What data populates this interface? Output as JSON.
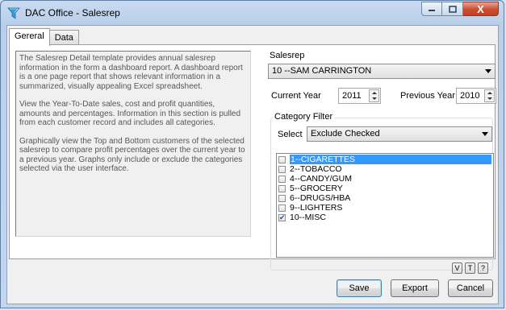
{
  "window": {
    "title": "DAC Office - Salesrep",
    "close_glyph": "X"
  },
  "tabs": [
    {
      "label": "Gereral"
    },
    {
      "label": "Data"
    }
  ],
  "description": {
    "p1": "The Salesrep Detail template provides annual salesrep information in the form a dashboard report. A dashboard report is a one page report that shows relevant information in a summarized, visually appealing Excel spreadsheet.",
    "p2": "View the Year-To-Date sales, cost and profit quantities, amounts and percentages. Information in this section is pulled from each customer record and includes all categories.",
    "p3": "Graphically view the Top and Bottom customers of the selected salesrep to compare profit percentages over the current year to a previous year. Graphs only include or exclude the categories selected via the user interface."
  },
  "salesrep": {
    "label": "Salesrep",
    "value": "10  --SAM CARRINGTON"
  },
  "current_year": {
    "label": "Current Year",
    "value": "2011"
  },
  "previous_year": {
    "label": "Previous Year",
    "value": "2010"
  },
  "category_filter": {
    "legend": "Category Filter",
    "select_label": "Select",
    "select_value": "Exclude Checked",
    "items": [
      {
        "label": "1--CIGARETTES",
        "checked": false,
        "selected": true
      },
      {
        "label": "2--TOBACCO",
        "checked": false,
        "selected": false
      },
      {
        "label": "4--CANDY/GUM",
        "checked": false,
        "selected": false
      },
      {
        "label": "5--GROCERY",
        "checked": false,
        "selected": false
      },
      {
        "label": "6--DRUGS/HBA",
        "checked": false,
        "selected": false
      },
      {
        "label": "9--LIGHTERS",
        "checked": false,
        "selected": false
      },
      {
        "label": "10--MISC",
        "checked": true,
        "selected": false
      }
    ]
  },
  "small_buttons": {
    "v": "V",
    "t": "T",
    "help": "?"
  },
  "buttons": {
    "save": "Save",
    "export": "Export",
    "cancel": "Cancel"
  }
}
